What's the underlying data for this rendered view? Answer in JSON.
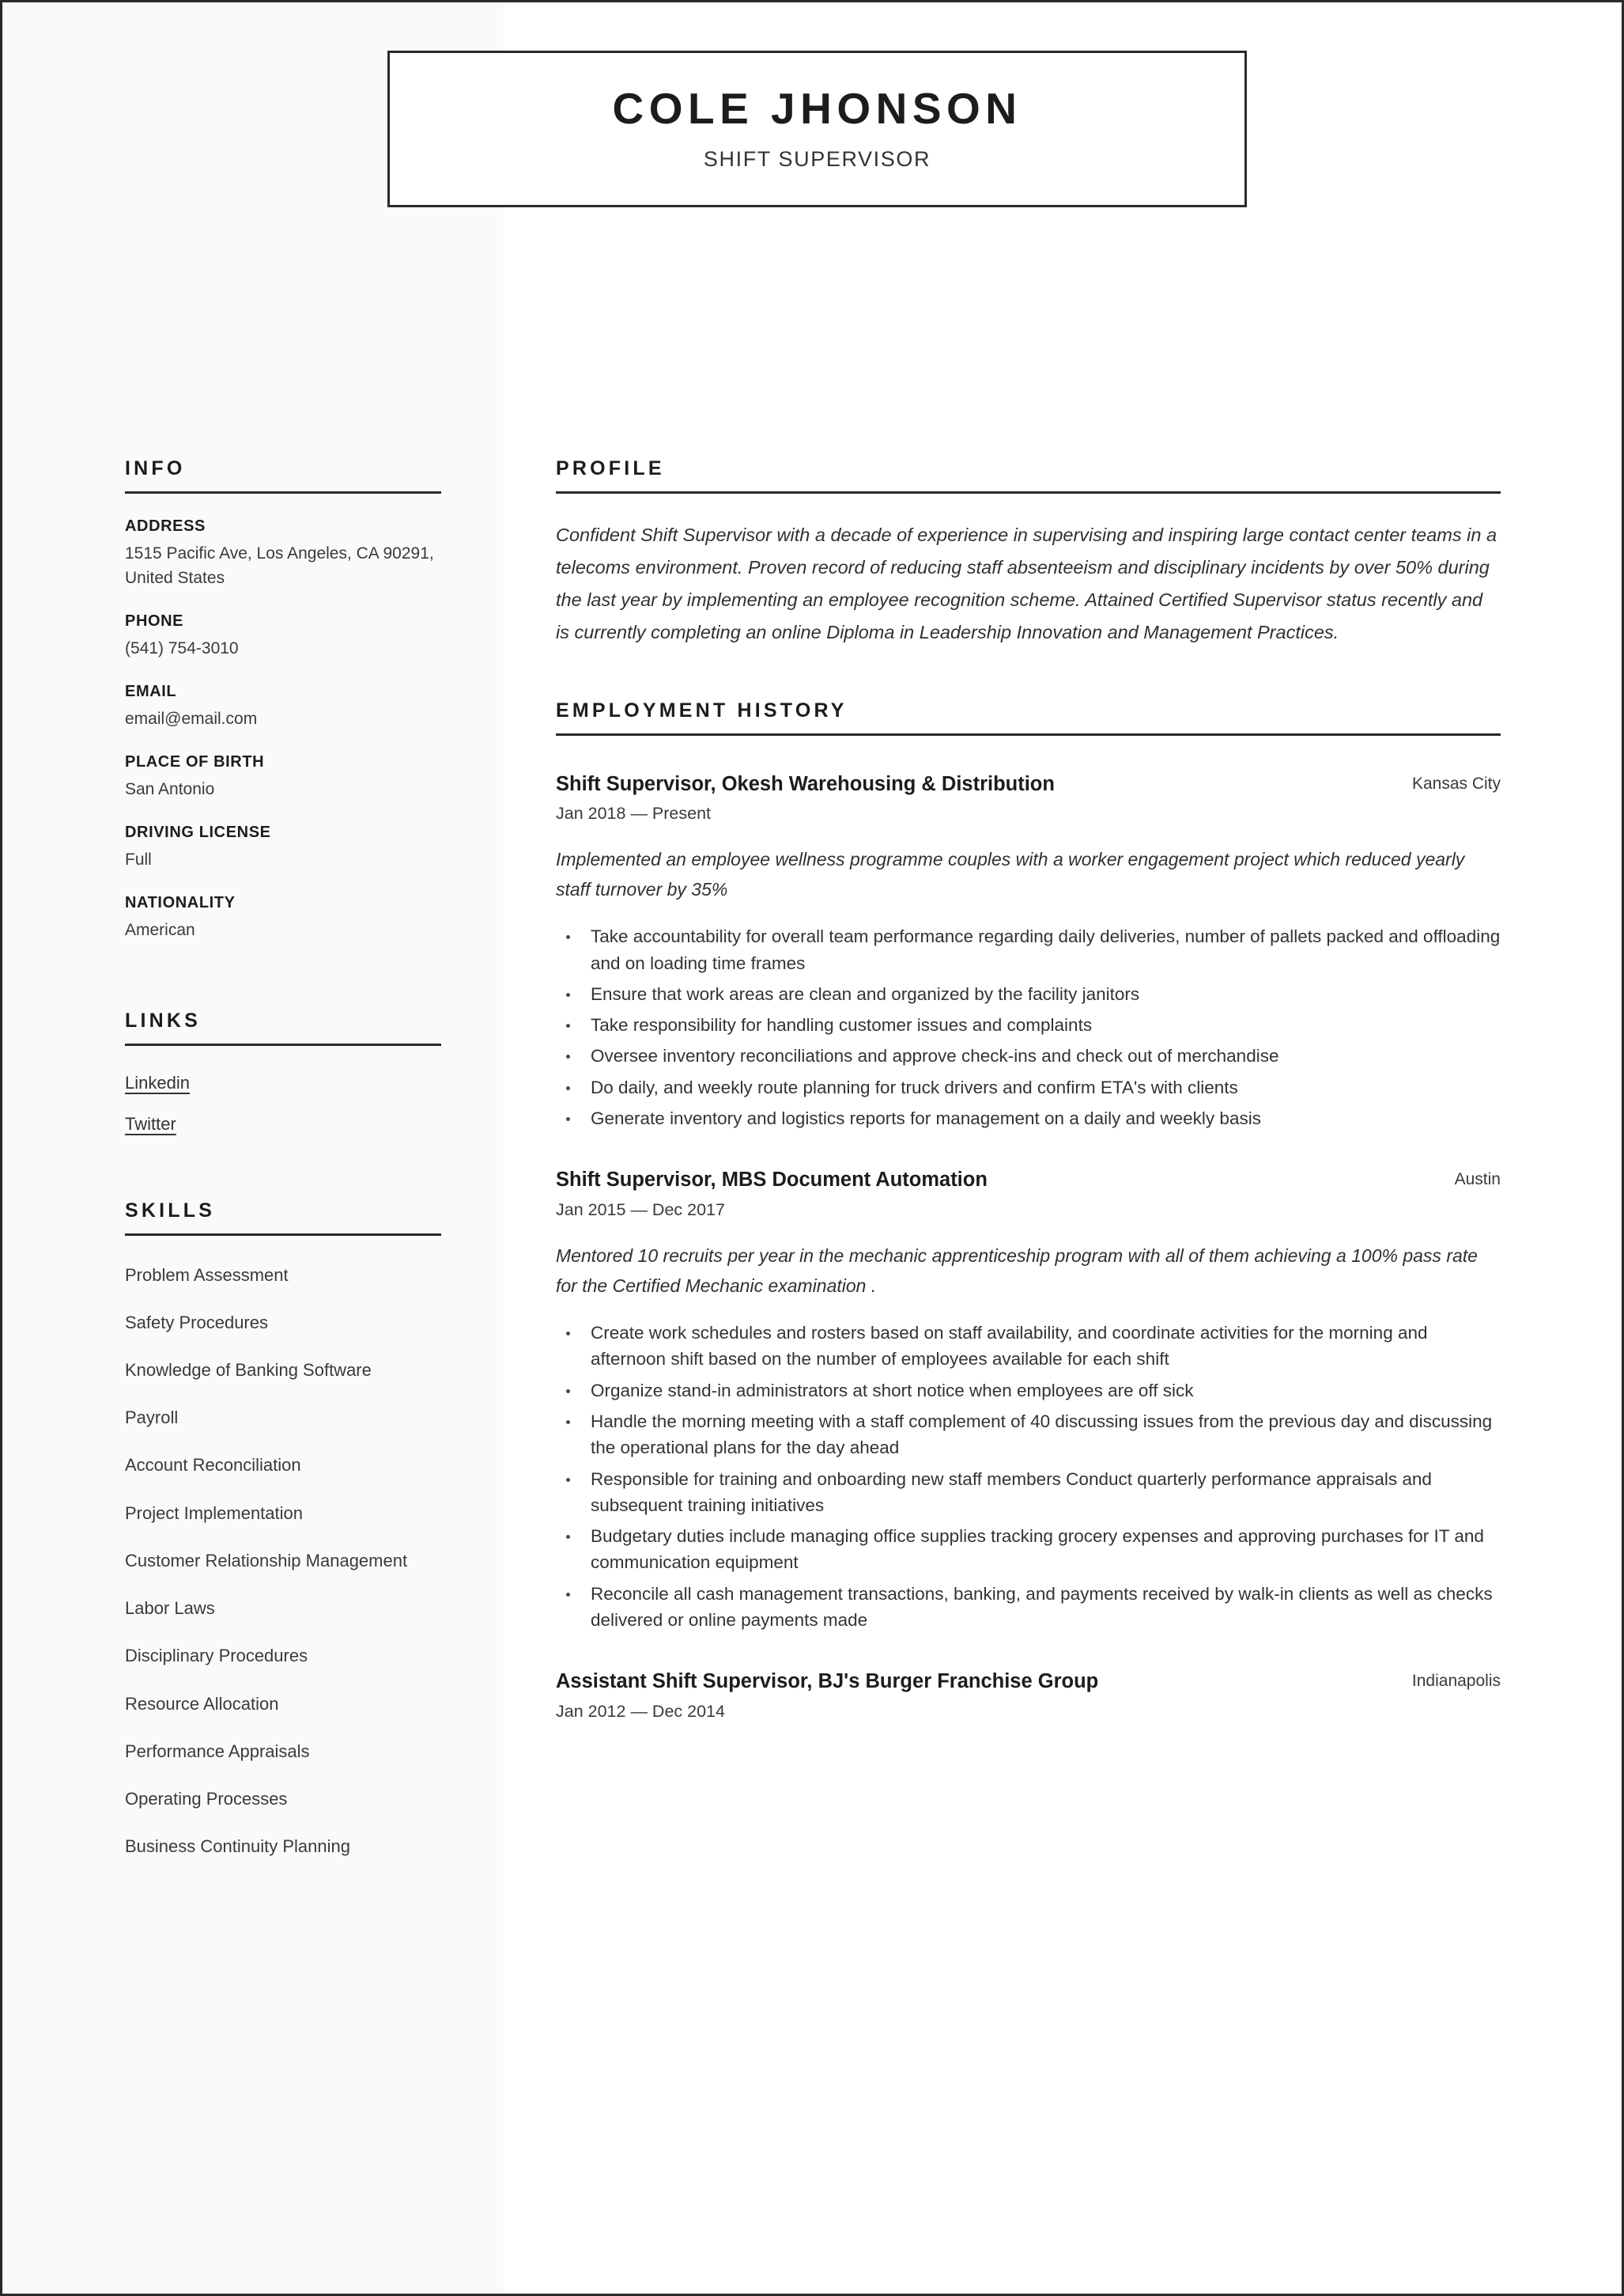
{
  "header": {
    "full_name": "COLE JHONSON",
    "job_title": "SHIFT SUPERVISOR"
  },
  "sidebar": {
    "info": {
      "heading": "INFO",
      "items": [
        {
          "label": "ADDRESS",
          "value": "1515 Pacific Ave, Los Angeles, CA 90291, United States"
        },
        {
          "label": "PHONE",
          "value": "(541) 754-3010"
        },
        {
          "label": "EMAIL",
          "value": "email@email.com"
        },
        {
          "label": "PLACE OF BIRTH",
          "value": "San Antonio"
        },
        {
          "label": "DRIVING LICENSE",
          "value": "Full"
        },
        {
          "label": "NATIONALITY",
          "value": "American"
        }
      ]
    },
    "links": {
      "heading": "LINKS",
      "items": [
        {
          "label": "Linkedin"
        },
        {
          "label": "Twitter"
        }
      ]
    },
    "skills": {
      "heading": "SKILLS",
      "items": [
        {
          "label": "Problem Assessment"
        },
        {
          "label": "Safety Procedures"
        },
        {
          "label": "Knowledge of Banking Software"
        },
        {
          "label": "Payroll"
        },
        {
          "label": "Account Reconciliation"
        },
        {
          "label": "Project Implementation"
        },
        {
          "label": "Customer Relationship Management"
        },
        {
          "label": "Labor Laws"
        },
        {
          "label": "Disciplinary Procedures"
        },
        {
          "label": "Resource Allocation"
        },
        {
          "label": "Performance Appraisals"
        },
        {
          "label": "Operating Processes"
        },
        {
          "label": "Business Continuity Planning"
        }
      ]
    }
  },
  "main": {
    "profile": {
      "heading": "PROFILE",
      "text": "Confident Shift Supervisor with a decade of experience in supervising and inspiring large contact center teams in a telecoms environment. Proven record of reducing staff absenteeism and disciplinary incidents by over 50% during the last year by implementing an employee recognition scheme. Attained Certified Supervisor status recently and is currently completing an online Diploma in Leadership Innovation and Management Practices."
    },
    "employment": {
      "heading": "EMPLOYMENT HISTORY",
      "jobs": [
        {
          "title": "Shift Supervisor, Okesh Warehousing & Distribution",
          "location": "Kansas City",
          "dates": "Jan 2018 — Present",
          "summary": "Implemented an employee wellness programme couples with a worker engagement project which reduced yearly staff turnover by 35%",
          "bullets": [
            "Take accountability for overall team performance regarding daily deliveries, number of pallets packed and offloading and on loading time frames",
            "Ensure that work areas are clean and organized by the facility janitors",
            "Take responsibility for handling customer issues and complaints",
            "Oversee inventory reconciliations and approve check-ins and check out of merchandise",
            "Do daily, and weekly route planning for truck drivers and confirm ETA's with clients",
            "Generate inventory and logistics reports for management on a daily and weekly basis"
          ]
        },
        {
          "title": "Shift Supervisor, MBS Document Automation",
          "location": "Austin",
          "dates": "Jan 2015 — Dec 2017",
          "summary": "Mentored 10 recruits per year in the mechanic apprenticeship program with all of them achieving a 100% pass rate for the Certified Mechanic examination .",
          "bullets": [
            "Create work schedules and rosters based on staff availability, and coordinate activities for the morning and afternoon shift based on the number of employees available for each shift",
            "Organize stand-in administrators at short notice when employees are off sick",
            "Handle the morning meeting with a staff complement of 40 discussing issues from the previous day and discussing the operational plans for the day ahead",
            "Responsible for training and onboarding new staff members Conduct quarterly performance appraisals and subsequent training initiatives",
            "Budgetary duties include managing office supplies tracking grocery expenses and approving purchases for IT and communication equipment",
            "Reconcile all cash management transactions, banking, and payments received by walk-in clients as well as checks delivered or online payments made"
          ]
        },
        {
          "title": "Assistant Shift Supervisor, BJ's Burger Franchise Group",
          "location": "Indianapolis",
          "dates": "Jan 2012 — Dec 2014",
          "summary": "",
          "bullets": []
        }
      ]
    }
  }
}
